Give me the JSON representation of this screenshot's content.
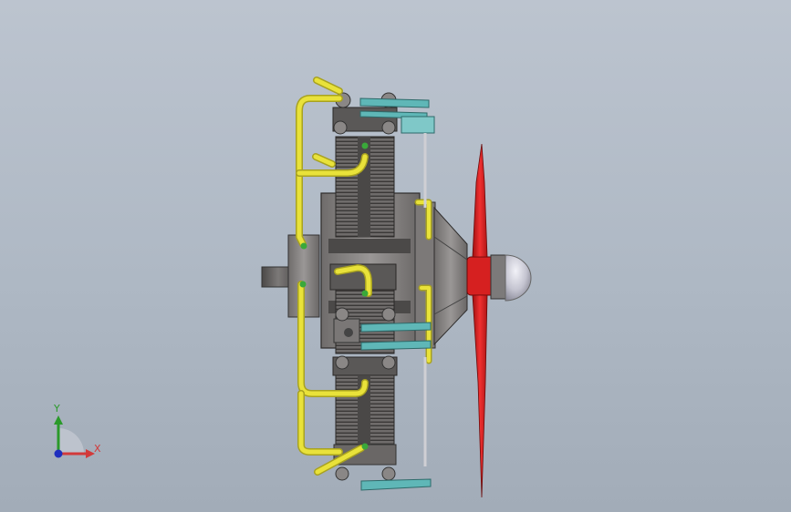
{
  "viewport": {
    "background_top": "#bcc4cf",
    "background_bottom": "#a2acb8"
  },
  "model": {
    "name": "radial-engine-assembly",
    "colors": {
      "cylinder": "#6a6766",
      "cylinder_dark": "#3e3c3b",
      "pipe": "#e9e23a",
      "pipe_shadow": "#a8a220",
      "rocker": "#5fb7b7",
      "propeller": "#e02020",
      "spinner": "#c9c9d6",
      "housing": "#8a8786"
    }
  },
  "triad": {
    "x_label": "X",
    "y_label": "Y",
    "x_color": "#d23a3a",
    "y_color": "#2a9a2a",
    "z_color": "#1f2fbf"
  }
}
